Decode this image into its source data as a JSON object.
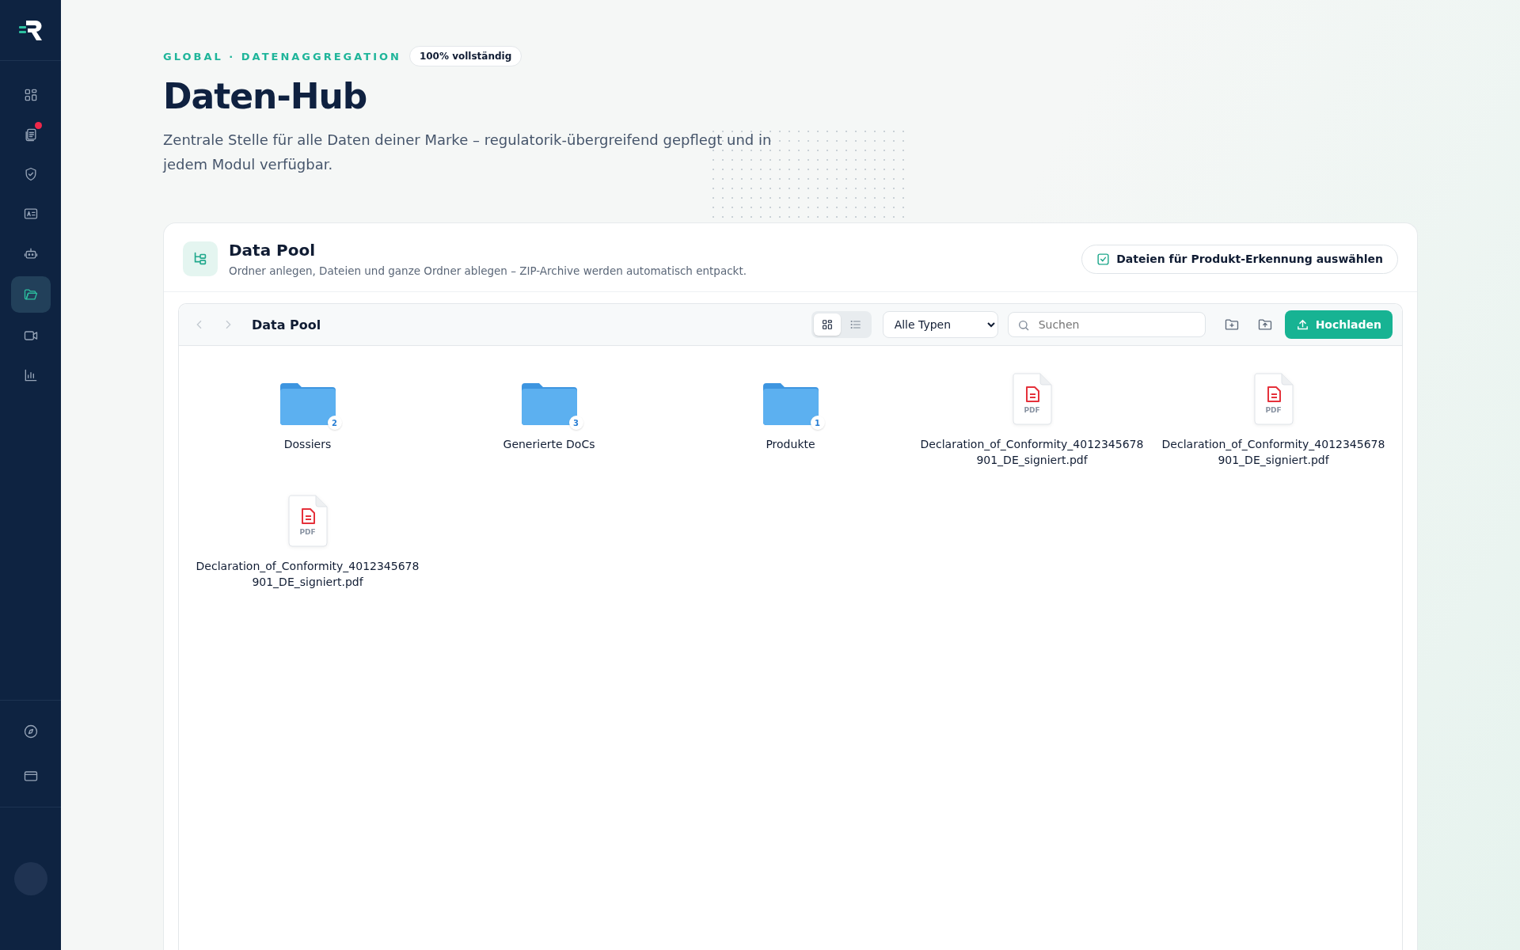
{
  "sidebar": {
    "nav": [
      {
        "selected": false,
        "badge": false
      },
      {
        "selected": false,
        "badge": true
      },
      {
        "selected": false,
        "badge": false
      },
      {
        "selected": false,
        "badge": false
      },
      {
        "selected": false,
        "badge": false
      },
      {
        "selected": true,
        "badge": false
      },
      {
        "selected": false,
        "badge": false
      },
      {
        "selected": false,
        "badge": false
      }
    ],
    "bottom": [
      {
        "selected": false
      },
      {
        "selected": false
      }
    ]
  },
  "header": {
    "eyebrow": "GLOBAL · DATENAGGREGATION",
    "status_badge": "100% vollständig",
    "title": "Daten-Hub",
    "description": "Zentrale Stelle für alle Daten deiner Marke – regulatorik-übergreifend gepflegt und in jedem Modul verfügbar."
  },
  "data_pool": {
    "title": "Data Pool",
    "subtitle": "Ordner anlegen, Dateien und ganze Ordner ablegen – ZIP-Archive werden automatisch entpackt.",
    "select_button": "Dateien für Produkt-Erkennung auswählen",
    "toolbar": {
      "back_disabled": true,
      "forward_disabled": true,
      "breadcrumb": "Data Pool",
      "views": [
        {
          "selected": true
        },
        {
          "selected": false
        }
      ],
      "type_filter": "Alle Typen",
      "search": {
        "placeholder": "Suchen"
      },
      "upload_button": "Hochladen"
    },
    "items": [
      {
        "kind": "folder",
        "name": "Dossiers",
        "count": "2"
      },
      {
        "kind": "folder",
        "name": "Generierte DoCs",
        "count": "3"
      },
      {
        "kind": "folder",
        "name": "Produkte",
        "count": "1"
      },
      {
        "kind": "pdf",
        "name": "Declaration_of_Conformity_4012345678901_DE_signiert.pdf",
        "label": "PDF"
      },
      {
        "kind": "pdf",
        "name": "Declaration_of_Conformity_4012345678901_DE_signiert.pdf",
        "label": "PDF"
      },
      {
        "kind": "pdf",
        "name": "Declaration_of_Conformity_4012345678901_DE_signiert.pdf",
        "label": "PDF"
      }
    ]
  }
}
